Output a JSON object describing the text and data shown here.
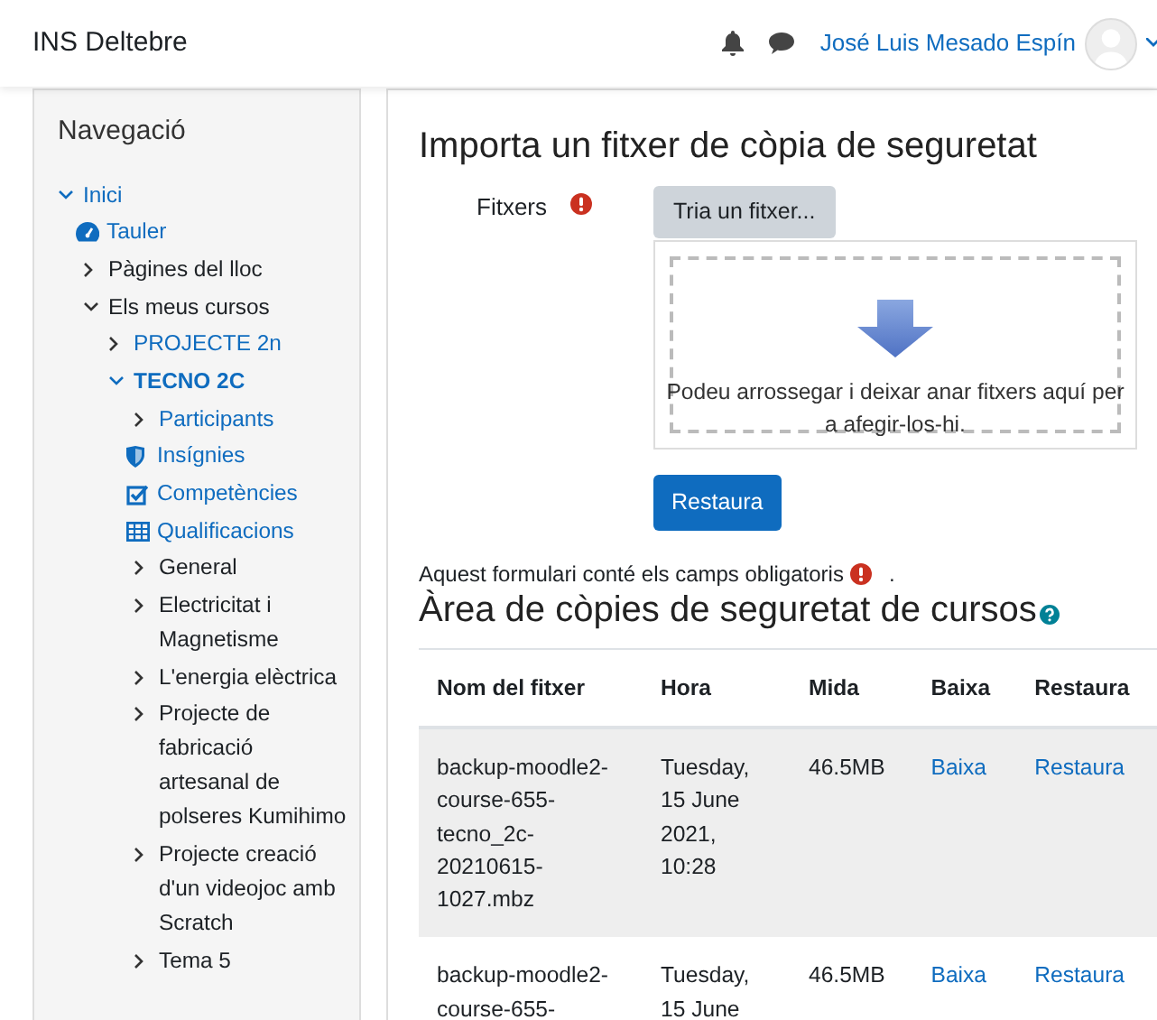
{
  "navbar": {
    "site_name": "INS Deltebre",
    "user_name": "José Luis Mesado Espín"
  },
  "navigation": {
    "title": "Navegació",
    "items": [
      {
        "label": "Inici",
        "kind": "branch",
        "expanded": true,
        "link": true,
        "current": false,
        "children": [
          {
            "label": "Tauler",
            "kind": "dashboard",
            "link": true,
            "current": false
          },
          {
            "label": "Pàgines del lloc",
            "kind": "branch",
            "expanded": false,
            "link": false,
            "current": false
          },
          {
            "label": "Els meus cursos",
            "kind": "branch",
            "expanded": true,
            "link": false,
            "current": false,
            "children": [
              {
                "label": "PROJECTE 2n",
                "kind": "branch",
                "expanded": false,
                "link": true,
                "current": false
              },
              {
                "label": "TECNO 2C",
                "kind": "branch",
                "expanded": true,
                "link": true,
                "current": true,
                "children": [
                  {
                    "label": "Participants",
                    "kind": "branch",
                    "expanded": false,
                    "link": true,
                    "current": false
                  },
                  {
                    "label": "Insígnies",
                    "kind": "badges",
                    "link": true,
                    "current": false
                  },
                  {
                    "label": "Competències",
                    "kind": "competencies",
                    "link": true,
                    "current": false
                  },
                  {
                    "label": "Qualificacions",
                    "kind": "grades",
                    "link": true,
                    "current": false
                  },
                  {
                    "label": "General",
                    "kind": "branch",
                    "expanded": false,
                    "link": false,
                    "current": false
                  },
                  {
                    "label": "Electricitat i Magnetisme",
                    "kind": "branch",
                    "expanded": false,
                    "link": false,
                    "current": false
                  },
                  {
                    "label": "L'energia elèctrica",
                    "kind": "branch",
                    "expanded": false,
                    "link": false,
                    "current": false
                  },
                  {
                    "label": "Projecte de fabricació artesanal de polseres Kumihimo",
                    "kind": "branch",
                    "expanded": false,
                    "link": false,
                    "current": false
                  },
                  {
                    "label": "Projecte creació d'un videojoc amb Scratch",
                    "kind": "branch",
                    "expanded": false,
                    "link": false,
                    "current": false
                  },
                  {
                    "label": "Tema 5",
                    "kind": "branch",
                    "expanded": false,
                    "link": false,
                    "current": false
                  }
                ]
              }
            ]
          }
        ]
      }
    ]
  },
  "import_form": {
    "title": "Importa un fitxer de còpia de seguretat",
    "field_label": "Fitxers",
    "choose_button": "Tria un fitxer...",
    "drop_hint": "Podeu arrossegar i deixar anar fitxers aquí per a afegir-los-hi.",
    "submit_button": "Restaura",
    "required_note": "Aquest formulari conté els camps obligatoris",
    "required_note_end": "."
  },
  "backup_area": {
    "title": "Àrea de còpies de seguretat de cursos",
    "table": {
      "columns": [
        "Nom del fitxer",
        "Hora",
        "Mida",
        "Baixa",
        "Restaura"
      ],
      "rows": [
        {
          "filename": "backup-moodle2-course-655-tecno_2c-20210615-1027.mbz",
          "time": "Tuesday, 15 June 2021, 10:28",
          "size": "46.5MB",
          "download": "Baixa",
          "restore": "Restaura",
          "highlighted": true
        },
        {
          "filename": "backup-moodle2-course-655-",
          "time": "Tuesday, 15 June",
          "size": "46.5MB",
          "download": "Baixa",
          "restore": "Restaura",
          "highlighted": false
        }
      ]
    }
  }
}
